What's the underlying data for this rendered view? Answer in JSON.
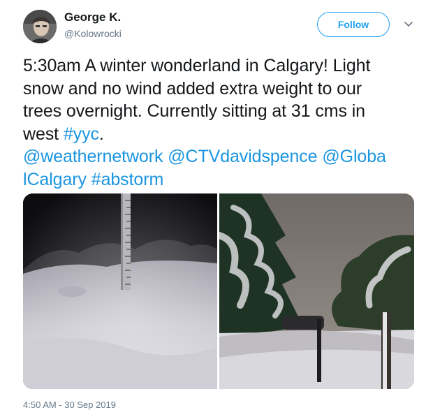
{
  "user": {
    "name": "George K.",
    "handle": "@Kolowrocki"
  },
  "actions": {
    "follow_label": "Follow"
  },
  "tweet": {
    "line1": "5:30am A winter wonderland in Calgary! Light",
    "line2": "snow and no wind added extra weight to our",
    "line3": "trees overnight. Currently sitting at 31 cms in",
    "line4_text": "west ",
    "hashtag_yyc": "#yyc",
    "line4_end": ".",
    "mention_weathernetwork": "@weathernetwork",
    "mention_ctv": "@CTVdavidspence",
    "mention_global_part1": "@Globa",
    "mention_global_part2": "lCalgary",
    "hashtag_abstorm": "#abstorm"
  },
  "timestamp": "4:50 AM - 30 Sep 2019",
  "colors": {
    "link": "#1b95e0",
    "follow_border": "#1da1f2",
    "secondary_text": "#657786"
  },
  "icons": {
    "caret": "chevron-down-icon"
  }
}
